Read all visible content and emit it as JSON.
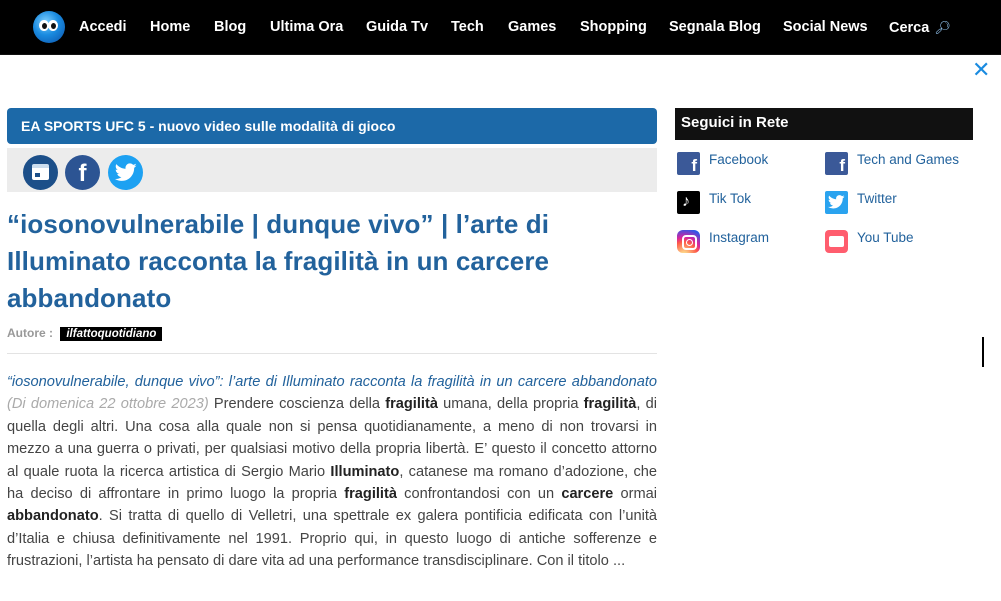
{
  "nav": {
    "items": [
      "Accedi",
      "Home",
      "Blog",
      "Ultima Ora",
      "Guida Tv",
      "Tech",
      "Games",
      "Shopping",
      "Segnala Blog",
      "Social News",
      "Cerca"
    ],
    "search_icon": "magnifier-icon"
  },
  "overlay": {
    "close_icon": "close-icon",
    "close_glyph": "✕"
  },
  "article": {
    "headline_bar": "EA SPORTS UFC 5 - nuovo video sulle modalità di gioco",
    "share_icons": [
      "calendar-icon",
      "facebook-icon",
      "twitter-icon"
    ],
    "title": "“iosonovulnerabile | dunque vivo” | l’arte di Illuminato racconta la fragilità in un carcere abbandonato",
    "author_label": "Autore :",
    "author": "ilfattoquotidiano",
    "lead": "“iosonovulnerabile, dunque vivo”: l’arte di Illuminato racconta la fragilità in un carcere abbandonato",
    "date": "(Di domenica 22 ottobre 2023)",
    "body_segments": [
      {
        "t": " Prendere coscienza della ",
        "b": false
      },
      {
        "t": "fragilità",
        "b": true
      },
      {
        "t": " umana, della propria ",
        "b": false
      },
      {
        "t": "fragilità",
        "b": true
      },
      {
        "t": ", di quella degli altri. Una cosa alla quale non si pensa quotidianamente, a meno di non trovarsi in mezzo a una guerra o privati, per qualsiasi motivo della propria libertà. E’ questo il concetto attorno al quale ruota la ricerca artistica di Sergio Mario ",
        "b": false
      },
      {
        "t": "Illuminato",
        "b": true
      },
      {
        "t": ", catanese ma romano d’adozione, che ha deciso di affrontare in primo luogo la propria ",
        "b": false
      },
      {
        "t": "fragilità",
        "b": true
      },
      {
        "t": " confrontandosi con un ",
        "b": false
      },
      {
        "t": "carcere",
        "b": true
      },
      {
        "t": " ormai ",
        "b": false
      },
      {
        "t": "abbandonato",
        "b": true
      },
      {
        "t": ". Si tratta di quello di Velletri, una spettrale ex galera pontificia edificata con l’unità d’Italia e chiusa definitivamente nel 1991. Proprio qui, in questo luogo di antiche sofferenze e frustrazioni, l’artista ha pensato di dare vita ad una performance transdisciplinare. Con il titolo ...",
        "b": false
      }
    ]
  },
  "sidebar": {
    "title": "Seguici in Rete",
    "links": [
      {
        "label": "Facebook",
        "icon": "facebook-icon"
      },
      {
        "label": "Tech and Games",
        "icon": "facebook-icon"
      },
      {
        "label": "Tik Tok",
        "icon": "tiktok-icon"
      },
      {
        "label": "Twitter",
        "icon": "twitter-icon"
      },
      {
        "label": "Instagram",
        "icon": "instagram-icon"
      },
      {
        "label": "You Tube",
        "icon": "youtube-icon"
      }
    ]
  },
  "colors": {
    "nav_bg": "#000000",
    "accent_blue": "#22629c",
    "headline_bar": "#1c69a8",
    "facebook": "#3b5998",
    "twitter": "#1da1f2"
  }
}
